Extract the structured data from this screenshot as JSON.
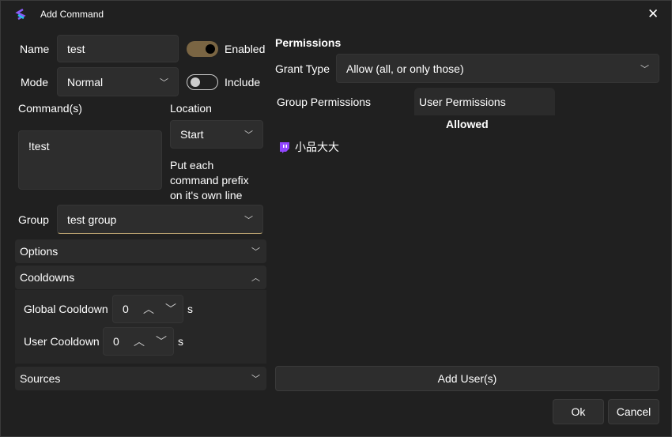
{
  "window": {
    "title": "Add Command",
    "close": "✕"
  },
  "form": {
    "name_label": "Name",
    "name_value": "test",
    "enabled_label": "Enabled",
    "enabled": true,
    "mode_label": "Mode",
    "mode_value": "Normal",
    "include_label": "Include",
    "include": false,
    "commands_label": "Command(s)",
    "commands_value": "!test",
    "location_label": "Location",
    "location_value": "Start",
    "hint": "Put each command prefix on it's own line",
    "group_label": "Group",
    "group_value": "test group"
  },
  "sections": {
    "options": "Options",
    "cooldowns": "Cooldowns",
    "sources": "Sources"
  },
  "cooldowns": {
    "global_label": "Global Cooldown",
    "global_value": "0",
    "user_label": "User Cooldown",
    "user_value": "0",
    "unit": "s"
  },
  "permissions": {
    "title": "Permissions",
    "grant_label": "Grant Type",
    "grant_value": "Allow (all, or only those)",
    "tabs": [
      "Group Permissions",
      "User Permissions"
    ],
    "column": "Allowed",
    "users": [
      "小品大大"
    ],
    "add_users": "Add User(s)"
  },
  "footer": {
    "ok": "Ok",
    "cancel": "Cancel"
  },
  "colors": {
    "toggle_on": "#7a6543",
    "twitch": "#9146ff"
  }
}
